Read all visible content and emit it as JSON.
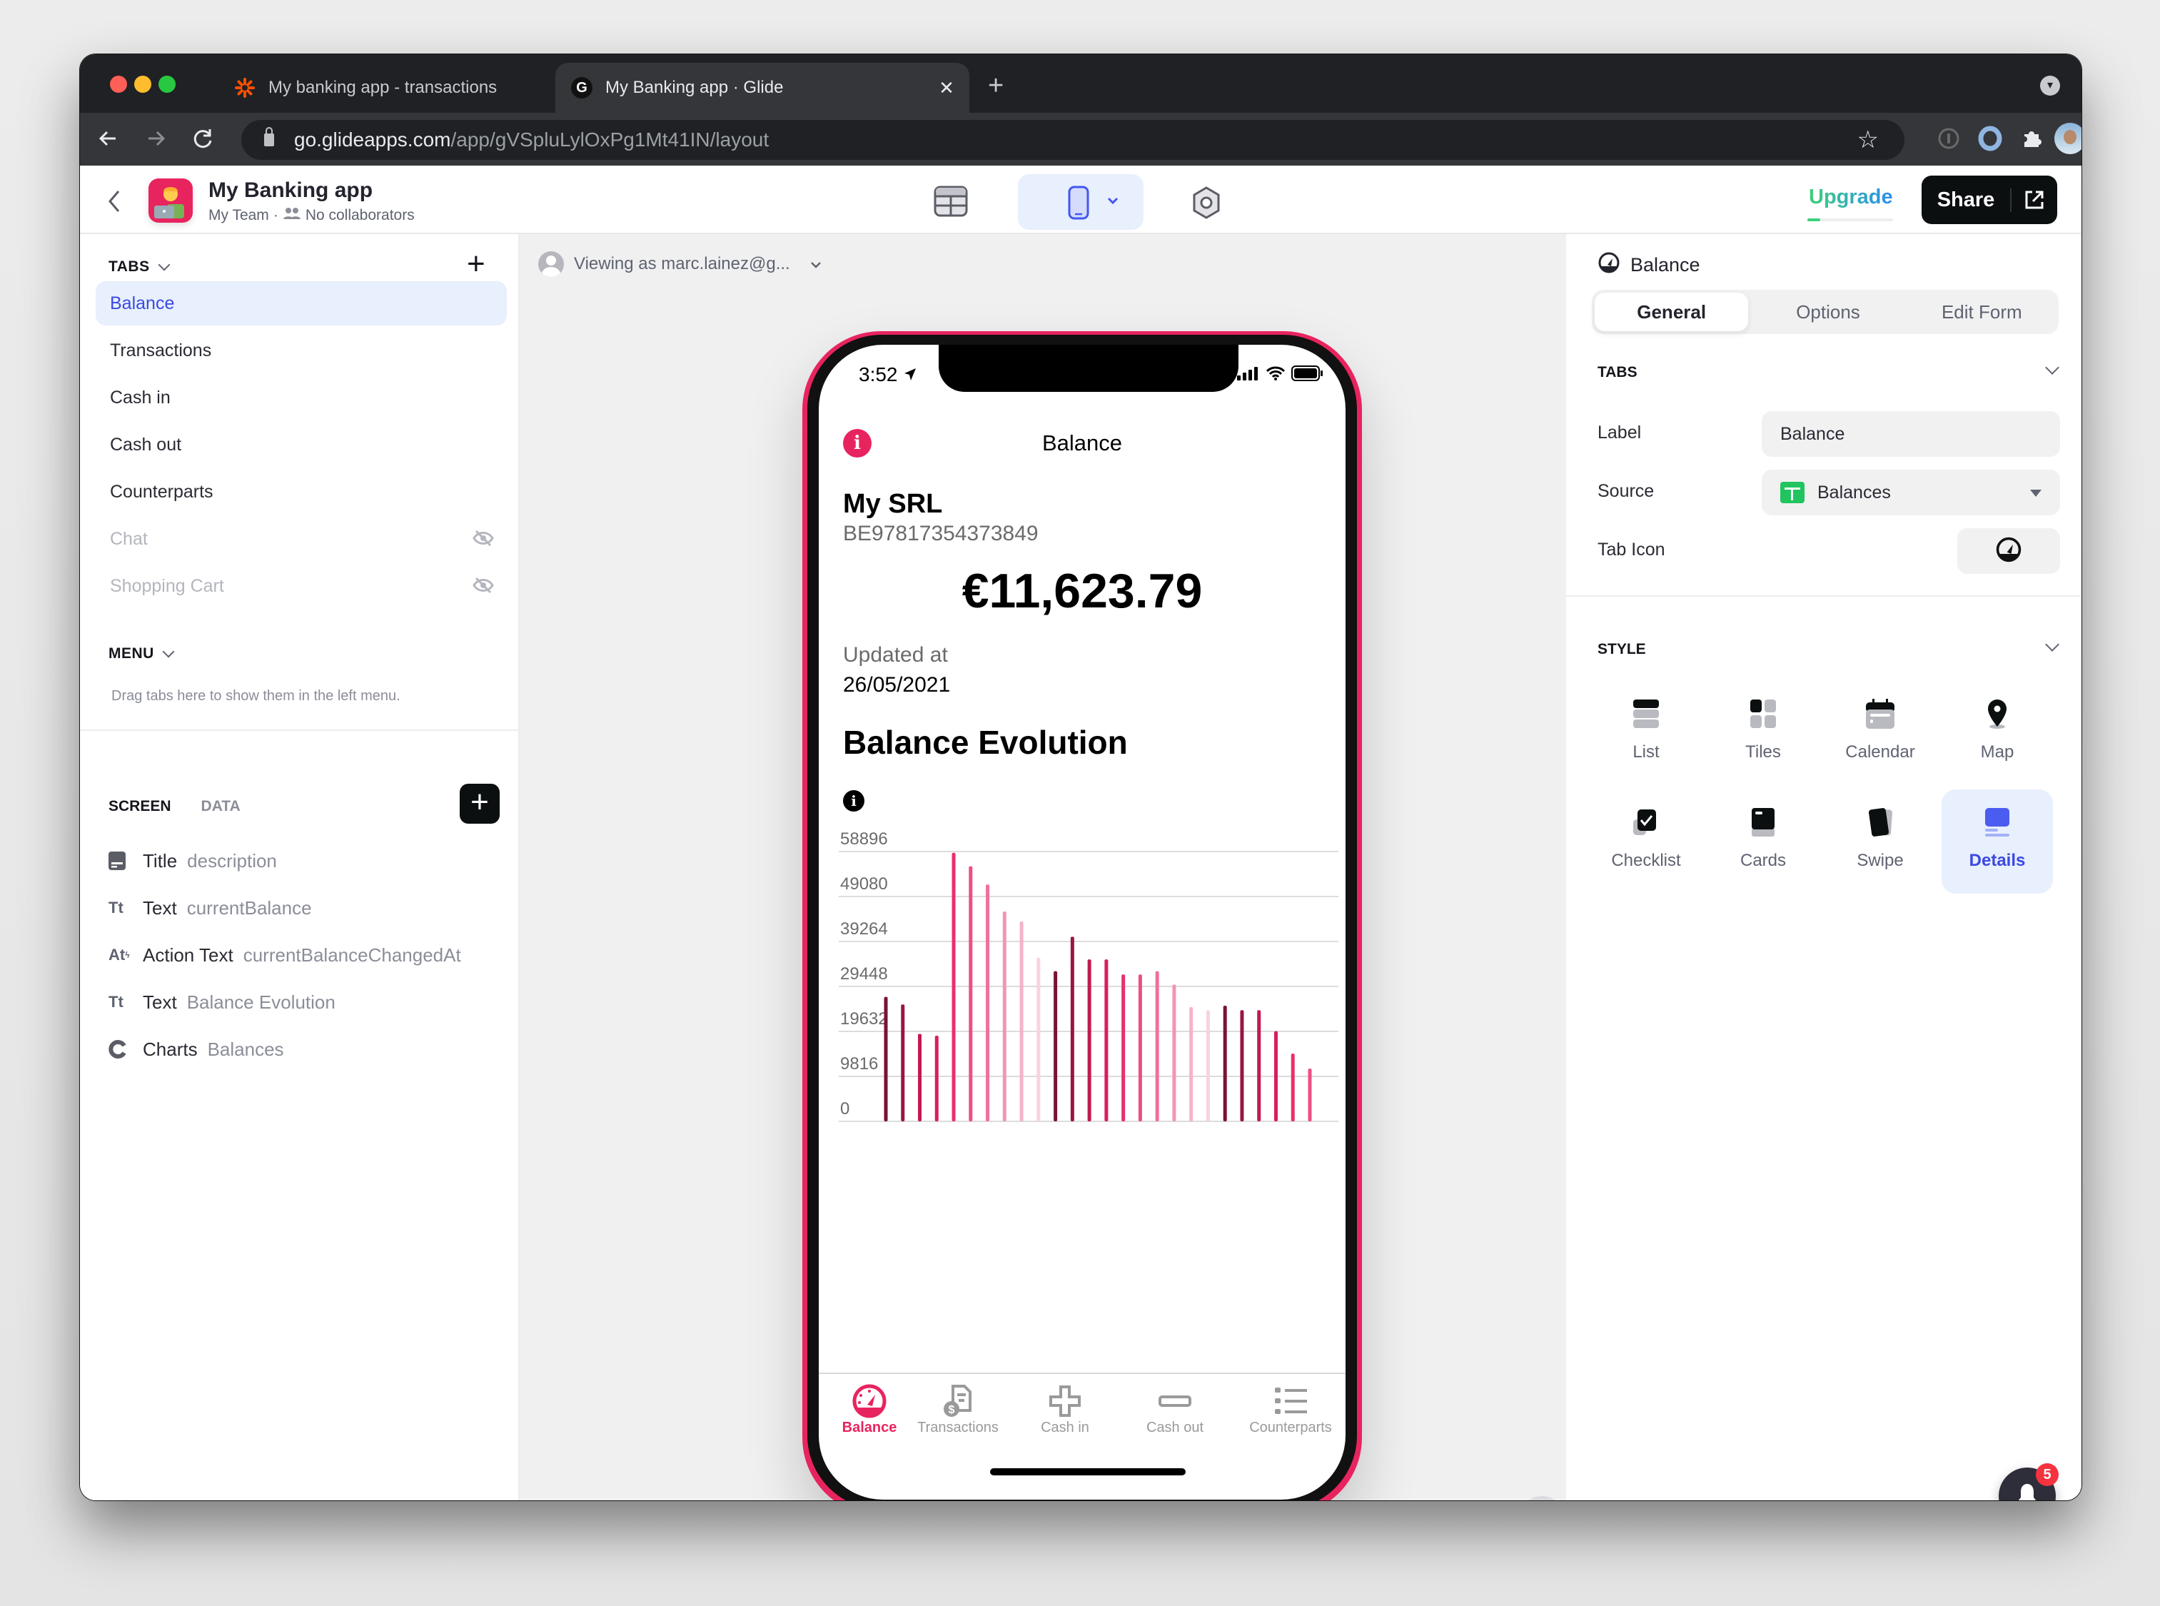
{
  "browser": {
    "tabs": [
      {
        "title": "My banking app - transactions",
        "favicon": "zapier-asterisk-icon",
        "active": false
      },
      {
        "title": "My Banking app · Glide",
        "favicon": "glide-g-icon",
        "active": true
      }
    ],
    "favicon_glyph": "G",
    "close_glyph": "✕",
    "new_tab_glyph": "+",
    "url_domain": "go.glideapps.com",
    "url_path": "/app/gVSpluLylOxPg1Mt41IN/layout"
  },
  "app_header": {
    "app_name": "My Banking app",
    "team": "My Team",
    "separator": "·",
    "collaborators": "No collaborators",
    "upgrade_label": "Upgrade",
    "share_label": "Share",
    "brand_color": "#e8245f",
    "accent_color": "#3b49e0"
  },
  "sidebar": {
    "tabs_heading": "TABS",
    "tabs": [
      {
        "label": "Balance",
        "selected": true,
        "hidden": false
      },
      {
        "label": "Transactions",
        "selected": false,
        "hidden": false
      },
      {
        "label": "Cash in",
        "selected": false,
        "hidden": false
      },
      {
        "label": "Cash out",
        "selected": false,
        "hidden": false
      },
      {
        "label": "Counterparts",
        "selected": false,
        "hidden": false
      },
      {
        "label": "Chat",
        "selected": false,
        "hidden": true
      },
      {
        "label": "Shopping Cart",
        "selected": false,
        "hidden": true
      }
    ],
    "menu_heading": "MENU",
    "menu_hint": "Drag tabs here to show them in the left menu.",
    "screen_tab": "SCREEN",
    "data_tab": "DATA",
    "components": [
      {
        "icon": "title-component-icon",
        "type": "Title",
        "value": "description"
      },
      {
        "icon": "text-component-icon",
        "type": "Text",
        "value": "currentBalance"
      },
      {
        "icon": "action-text-component-icon",
        "type": "Action Text",
        "value": "currentBalanceChangedAt"
      },
      {
        "icon": "text-component-icon",
        "type": "Text",
        "value": "Balance Evolution"
      },
      {
        "icon": "charts-component-icon",
        "type": "Charts",
        "value": "Balances"
      }
    ]
  },
  "canvas": {
    "viewing_as": "Viewing as marc.lainez@g...",
    "phone": {
      "status_time": "3:52",
      "screen_title": "Balance",
      "company": "My SRL",
      "iban": "BE97817354373849",
      "balance": "€11,623.79",
      "updated_label": "Updated at",
      "updated_date": "26/05/2021",
      "section_title": "Balance Evolution",
      "bottom_tabs": [
        {
          "label": "Balance",
          "icon": "gauge-icon",
          "active": true
        },
        {
          "label": "Transactions",
          "icon": "receipt-dollar-icon",
          "active": false
        },
        {
          "label": "Cash in",
          "icon": "plus-icon",
          "active": false
        },
        {
          "label": "Cash out",
          "icon": "minus-icon",
          "active": false
        },
        {
          "label": "Counterparts",
          "icon": "list-icon",
          "active": false
        }
      ]
    }
  },
  "right_panel": {
    "title": "Balance",
    "segments": [
      "General",
      "Options",
      "Edit Form"
    ],
    "active_segment": "General",
    "tabs_heading": "TABS",
    "label_field": {
      "label": "Label",
      "value": "Balance"
    },
    "source_field": {
      "label": "Source",
      "value": "Balances"
    },
    "tab_icon_label": "Tab Icon",
    "style_heading": "STYLE",
    "styles": [
      {
        "label": "List",
        "icon": "list-style-icon",
        "selected": false
      },
      {
        "label": "Tiles",
        "icon": "tiles-style-icon",
        "selected": false
      },
      {
        "label": "Calendar",
        "icon": "calendar-style-icon",
        "selected": false
      },
      {
        "label": "Map",
        "icon": "map-pin-icon",
        "selected": false
      },
      {
        "label": "Checklist",
        "icon": "checklist-style-icon",
        "selected": false
      },
      {
        "label": "Cards",
        "icon": "cards-style-icon",
        "selected": false
      },
      {
        "label": "Swipe",
        "icon": "swipe-style-icon",
        "selected": false
      },
      {
        "label": "Details",
        "icon": "details-style-icon",
        "selected": true
      }
    ],
    "notification_count": "5"
  },
  "chart_data": {
    "type": "bar",
    "title": "Balance Evolution",
    "xlabel": "",
    "ylabel": "",
    "yticks": [
      0,
      9816,
      19632,
      29448,
      39264,
      49080,
      58896
    ],
    "ytick_labels": [
      "0",
      "9816",
      "19632",
      "29448",
      "39264",
      "49080",
      "58896"
    ],
    "ylim": [
      0,
      58896
    ],
    "grid": true,
    "legend": "none",
    "values": [
      27160,
      25520,
      19090,
      18700,
      58620,
      55680,
      51690,
      45800,
      43620,
      35720,
      32770,
      40300,
      35340,
      35340,
      32060,
      32060,
      32770,
      29830,
      24920,
      24270,
      25250,
      24270,
      24270,
      19690,
      14780,
      11510
    ],
    "palette": [
      "#7a1237",
      "#991641",
      "#c21a4f",
      "#d91e5c",
      "#e8306a",
      "#ec4f82",
      "#f0709a",
      "#f295b4",
      "#f6b3c8",
      "#f9d3df"
    ]
  }
}
